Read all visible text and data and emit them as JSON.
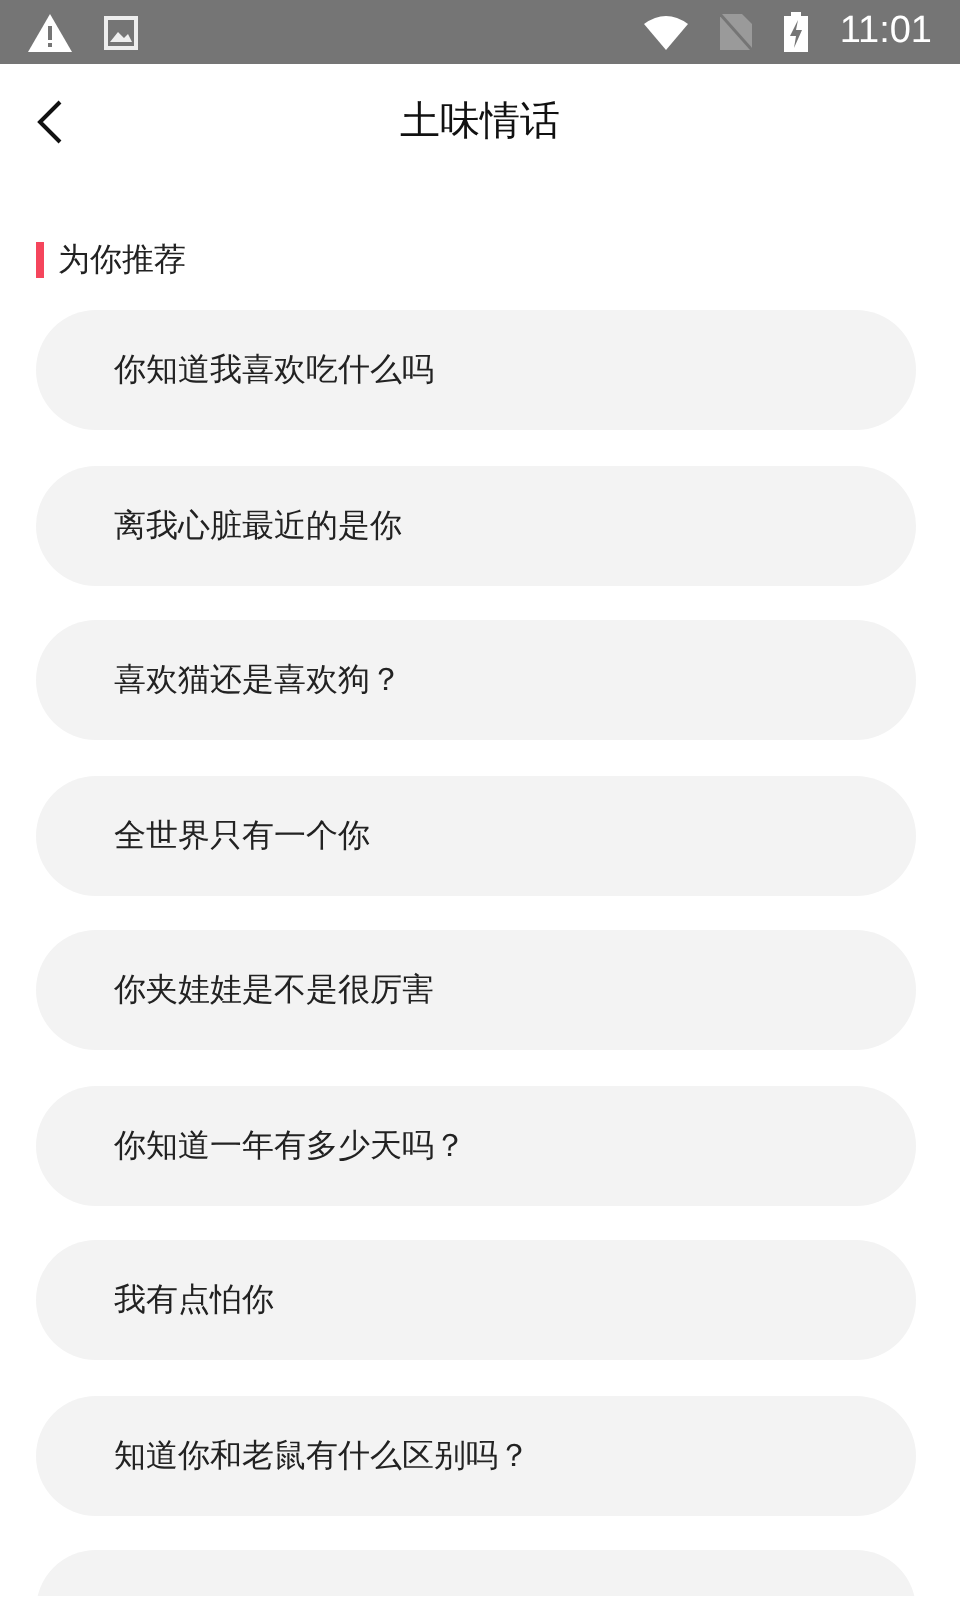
{
  "status_bar": {
    "time": "11:01"
  },
  "header": {
    "title": "土味情话"
  },
  "section": {
    "title": "为你推荐"
  },
  "items": [
    {
      "text": "你知道我喜欢吃什么吗"
    },
    {
      "text": "离我心脏最近的是你"
    },
    {
      "text": "喜欢猫还是喜欢狗？"
    },
    {
      "text": "全世界只有一个你"
    },
    {
      "text": "你夹娃娃是不是很厉害"
    },
    {
      "text": "你知道一年有多少天吗？"
    },
    {
      "text": "我有点怕你"
    },
    {
      "text": "知道你和老鼠有什么区别吗？"
    },
    {
      "kind": "cut_off"
    }
  ]
}
